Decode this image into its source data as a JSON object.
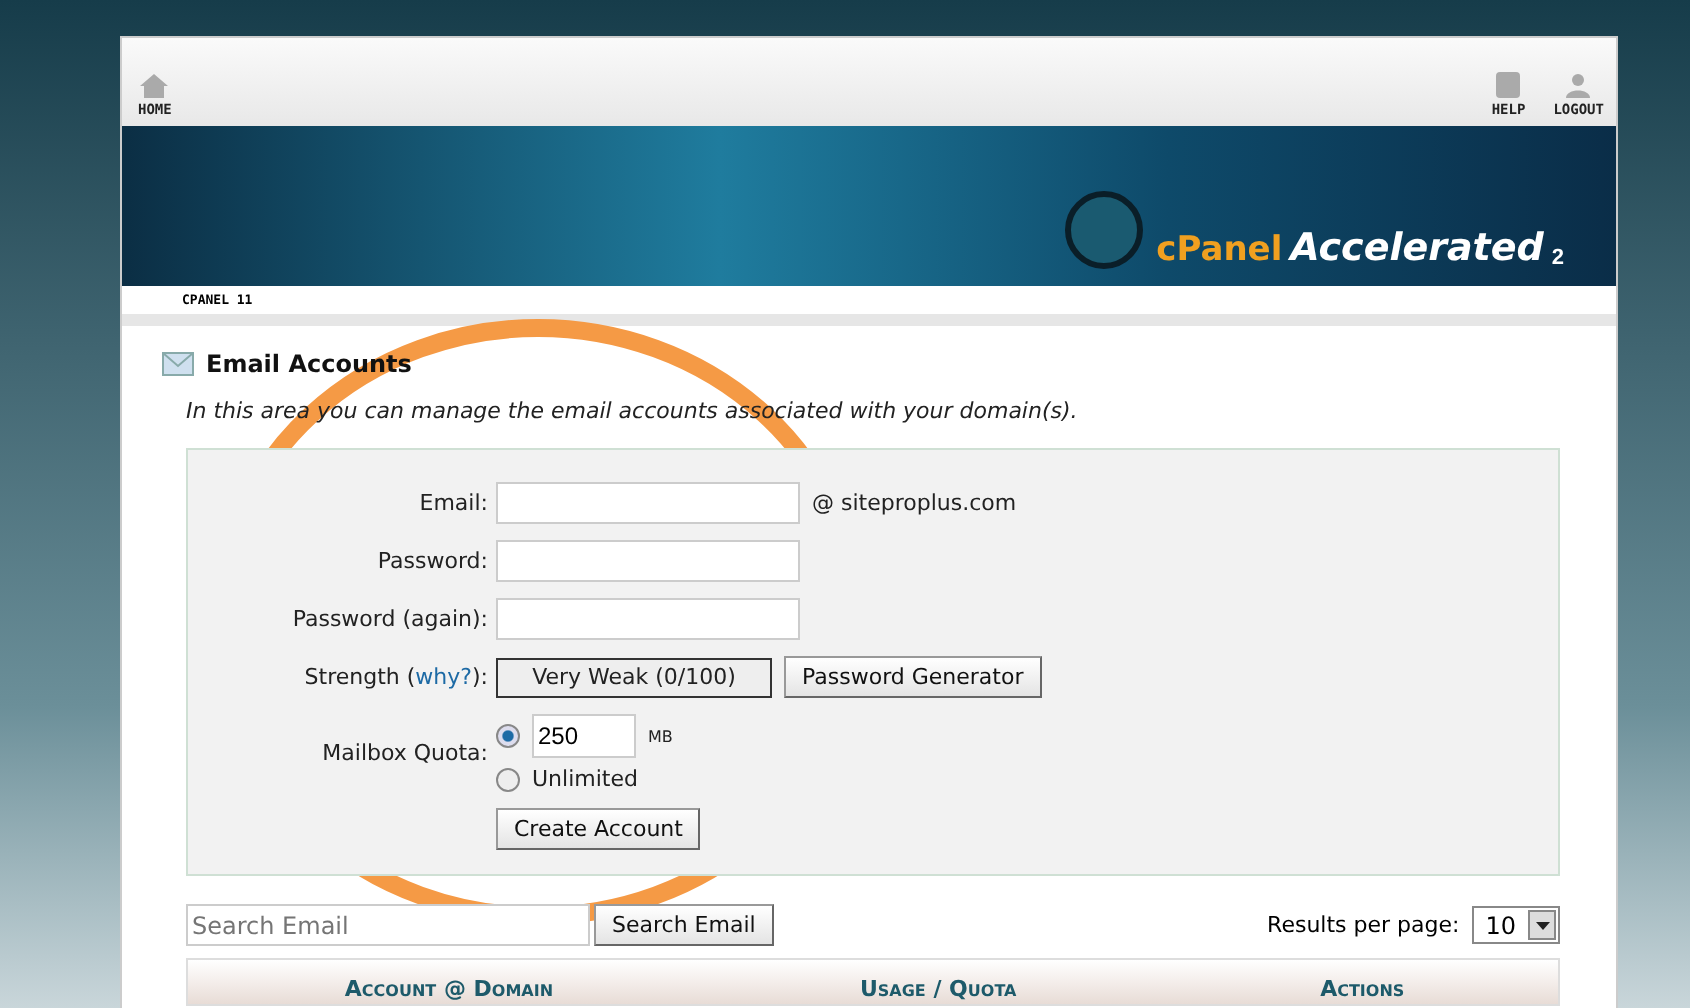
{
  "nav": {
    "home": "HOME",
    "help": "HELP",
    "logout": "LOGOUT"
  },
  "banner": {
    "brand": "cPanel",
    "product": "Accelerated",
    "version": "2"
  },
  "breadcrumb": "CPANEL 11",
  "section": {
    "title": "Email Accounts",
    "description": "In this area you can manage the email accounts associated with your domain(s)."
  },
  "form": {
    "email_label": "Email:",
    "domain": "@ siteproplus.com",
    "password_label": "Password:",
    "password_again_label": "Password (again):",
    "strength_label": "Strength (",
    "strength_link": "why?",
    "strength_label_end": "):",
    "strength_value": "Very Weak (0/100)",
    "generator_button": "Password Generator",
    "quota_label": "Mailbox Quota:",
    "quota_options": [
      {
        "kind": "amount",
        "value": "250",
        "unit": "MB",
        "selected": true
      },
      {
        "kind": "unlimited",
        "label": "Unlimited",
        "selected": false
      }
    ],
    "create_button": "Create Account"
  },
  "search": {
    "placeholder": "Search Email",
    "button": "Search Email",
    "per_page_label": "Results per page:",
    "per_page_value": "10"
  },
  "table": {
    "columns": [
      {
        "parts": [
          "Account",
          " @ ",
          "Domain"
        ]
      },
      {
        "parts": [
          "Usage",
          " / ",
          "Quota"
        ]
      },
      {
        "parts": [
          "Actions"
        ]
      }
    ]
  }
}
